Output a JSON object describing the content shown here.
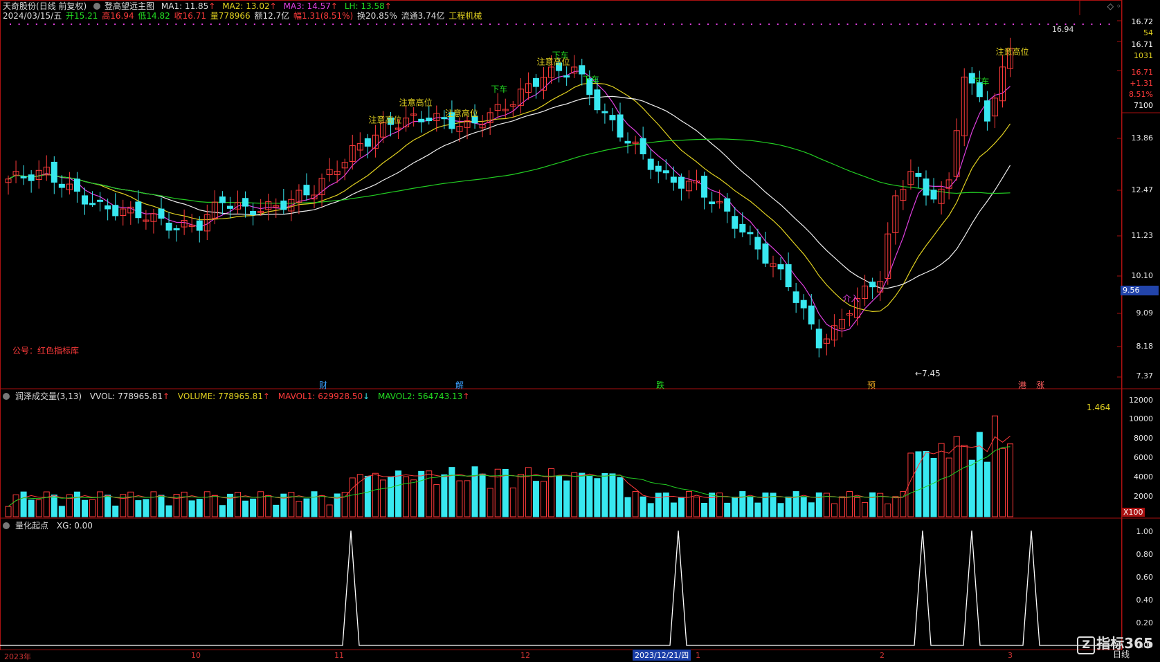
{
  "app": {
    "stock_name": "天奇股份",
    "period_label": "(日线 前复权)",
    "indicator_name": "登高望远主图"
  },
  "main_header": {
    "ma1": "MA1: 11.85",
    "ma2": "MA2: 13.02",
    "ma3": "MA3: 14.57",
    "lh": "LH: 13.58",
    "date": "2024/03/15/五",
    "open": "开15.21",
    "high": "高16.94",
    "low": "低14.82",
    "close": "收16.71",
    "volume": "量778966",
    "amount": "额12.7亿",
    "change": "幅1.31(8.51%)",
    "turnover": "换20.85%",
    "float": "流通3.74亿",
    "industry": "工程机械"
  },
  "colors": {
    "ma1": "#e040e0",
    "ma2": "#e0d020",
    "ma3": "#eeeeee",
    "long": "#22cc22",
    "up": "#ff3b3b",
    "down": "#38e8f0"
  },
  "price_axis": [
    "16.72",
    "16.71",
    "16.71",
    "13.86",
    "12.47",
    "11.23",
    "10.10",
    "9.09",
    "8.18",
    "7.37"
  ],
  "right_tags": {
    "top_price": "16.72",
    "vol_top": "54",
    "close": "16.71",
    "vol2": "1031",
    "close2": "16.71",
    "chg": "+1.31",
    "pct": "8.51%",
    "num": "7100",
    "cursor_price": "9.56"
  },
  "annotations": {
    "low_marker": "←7.45",
    "high_marker": "16.94",
    "public_note": "公号：红色指标库",
    "caution": "注意高位",
    "stop": "下车",
    "buy": "介入",
    "events": [
      "财",
      "解",
      "跌",
      "预",
      "港",
      "涨"
    ]
  },
  "volume_header": {
    "name": "润泽成交量(3,13)",
    "vvol": "VVOL: 778965.81",
    "volume": "VOLUME: 778965.81",
    "mavol1": "MAVOL1: 629928.50",
    "mavol2": "MAVOL2: 564743.13"
  },
  "volume_axis": [
    "12000",
    "10000",
    "8000",
    "6000",
    "4000",
    "2000"
  ],
  "volume_unit": "X100",
  "volume_value_label": "1.464",
  "signal_header": {
    "name": "量化起点",
    "xg": "XG: 0.00"
  },
  "signal_axis": [
    "1.00",
    "0.80",
    "0.60",
    "0.40",
    "0.20",
    "0.00"
  ],
  "x_axis": {
    "labels": [
      "2023年",
      "10",
      "11",
      "12",
      "1",
      "2",
      "3"
    ],
    "cursor_date": "2023/12/21/四",
    "mode": "日线"
  },
  "watermark": "指标365"
}
